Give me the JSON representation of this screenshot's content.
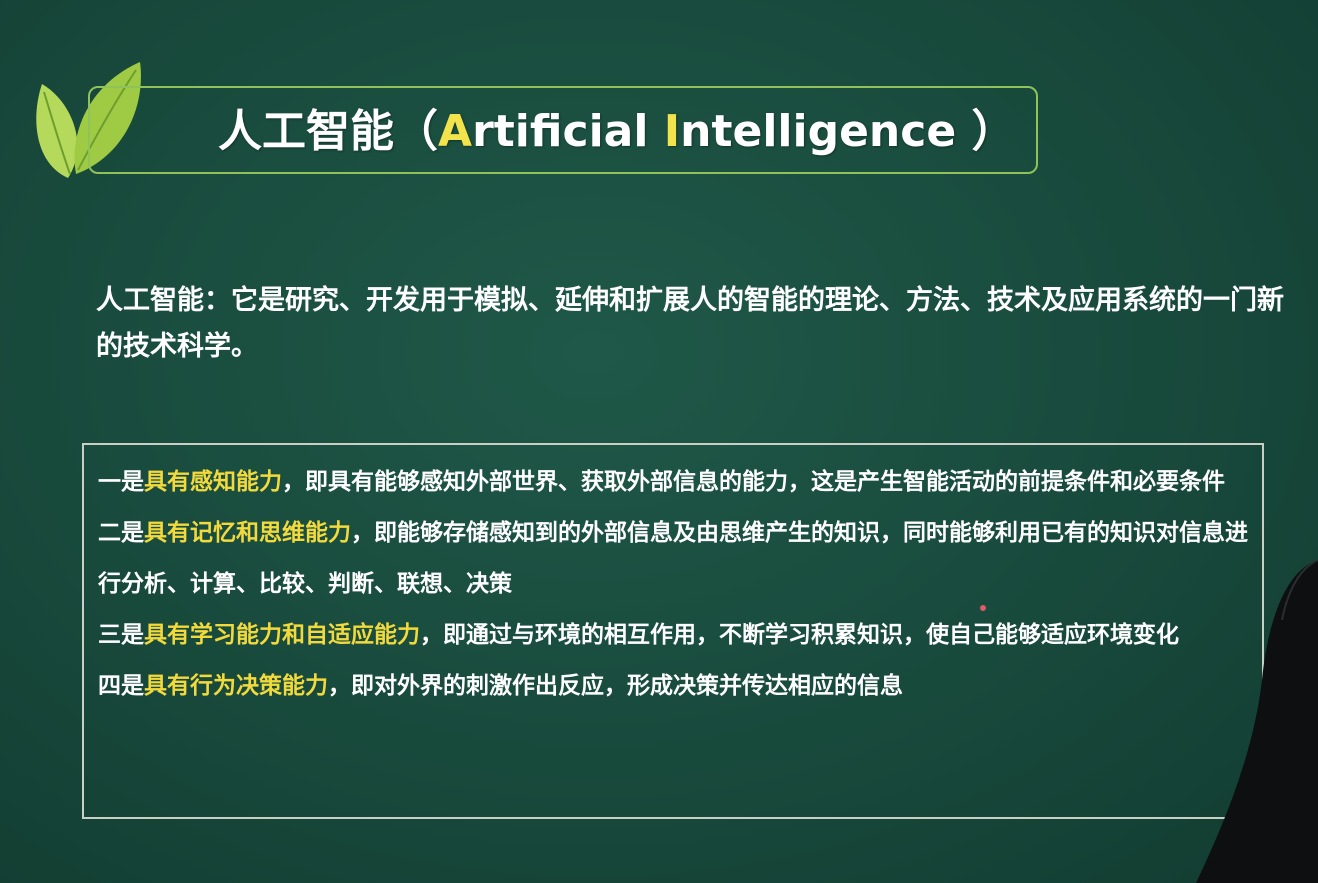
{
  "slide": {
    "title": {
      "cn": "人工智能",
      "open_paren": "（",
      "a_letter": "A",
      "rtificial": "rtificial",
      "space": " ",
      "i_letter": "I",
      "ntelligence": "ntelligence",
      "close_paren": " ）"
    },
    "definition": "人工智能：它是研究、开发用于模拟、延伸和扩展人的智能的理论、方法、技术及应用系统的一门新的技术科学。",
    "points": [
      {
        "prefix": "一是",
        "highlight": "具有感知能力",
        "rest": "，即具有能够感知外部世界、获取外部信息的能力，这是产生智能活动的前提条件和必要条件"
      },
      {
        "prefix": "二是",
        "highlight": "具有记忆和思维能力",
        "rest": "，即能够存储感知到的外部信息及由思维产生的知识，同时能够利用已有的知识对信息进行分析、计算、比较、判断、联想、决策"
      },
      {
        "prefix": "三是",
        "highlight": "具有学习能力和自适应能力",
        "rest": "，即通过与环境的相互作用，不断学习积累知识，使自己能够适应环境变化"
      },
      {
        "prefix": "四是",
        "highlight": "具有行为决策能力",
        "rest": "，即对外界的刺激作出反应，形成决策并传达相应的信息"
      }
    ]
  },
  "colors": {
    "background": "#1a4d3f",
    "frame_green": "#8fc25a",
    "highlight_yellow": "#f2d93c",
    "leaf_light": "#c3e06a",
    "leaf_dark": "#8cbf3a"
  },
  "icons": {
    "logo": "green-leaves-icon"
  }
}
